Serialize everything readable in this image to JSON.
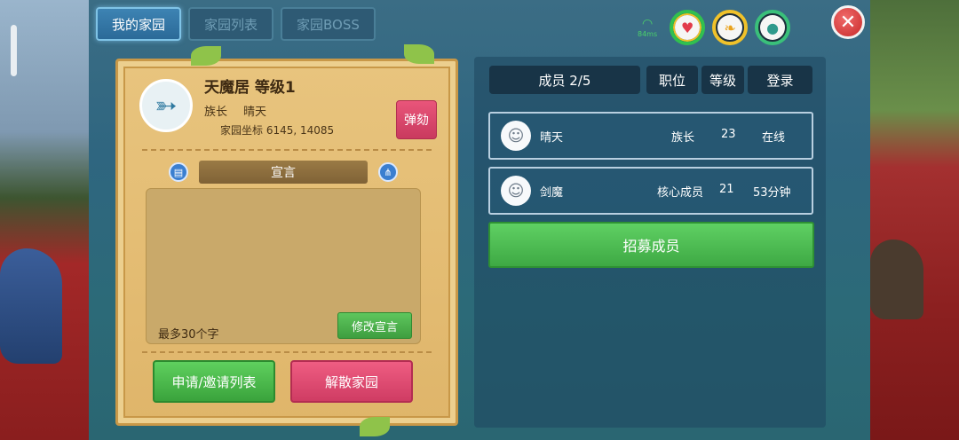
{
  "tabs": [
    {
      "label": "我的家园",
      "active": true
    },
    {
      "label": "家园列表",
      "active": false
    },
    {
      "label": "家园BOSS",
      "active": false
    }
  ],
  "hud": {
    "ping": "84ms",
    "icons": [
      "wifi-icon",
      "heart-icon",
      "food-icon",
      "water-drop-icon"
    ],
    "close_icon": "close-icon"
  },
  "home": {
    "emblem_icon": "fish-icon",
    "name": "天魔居 等级1",
    "leader_label": "族长",
    "leader_name": "晴天",
    "coords": "家园坐标 6145, 14085",
    "impeach_label": "弹劾"
  },
  "manifesto": {
    "title": "宣言",
    "left_icon": "document-icon",
    "right_icon": "share-icon",
    "char_limit": "最多30个字",
    "edit_label": "修改宣言"
  },
  "actions": {
    "invite_label": "申请/邀请列表",
    "disband_label": "解散家园"
  },
  "members": {
    "header": {
      "count": "成员 2/5",
      "role": "职位",
      "level": "等级",
      "login": "登录"
    },
    "rows": [
      {
        "name": "晴天",
        "role": "族长",
        "level": "23",
        "login": "在线"
      },
      {
        "name": "剑魔",
        "role": "核心成员",
        "level": "21",
        "login": "53分钟"
      }
    ],
    "recruit_label": "招募成员"
  },
  "colors": {
    "accent_green": "#3ea944",
    "accent_red": "#cf3c63",
    "panel_blue": "#2f6680",
    "parchment": "#e4bd74"
  }
}
